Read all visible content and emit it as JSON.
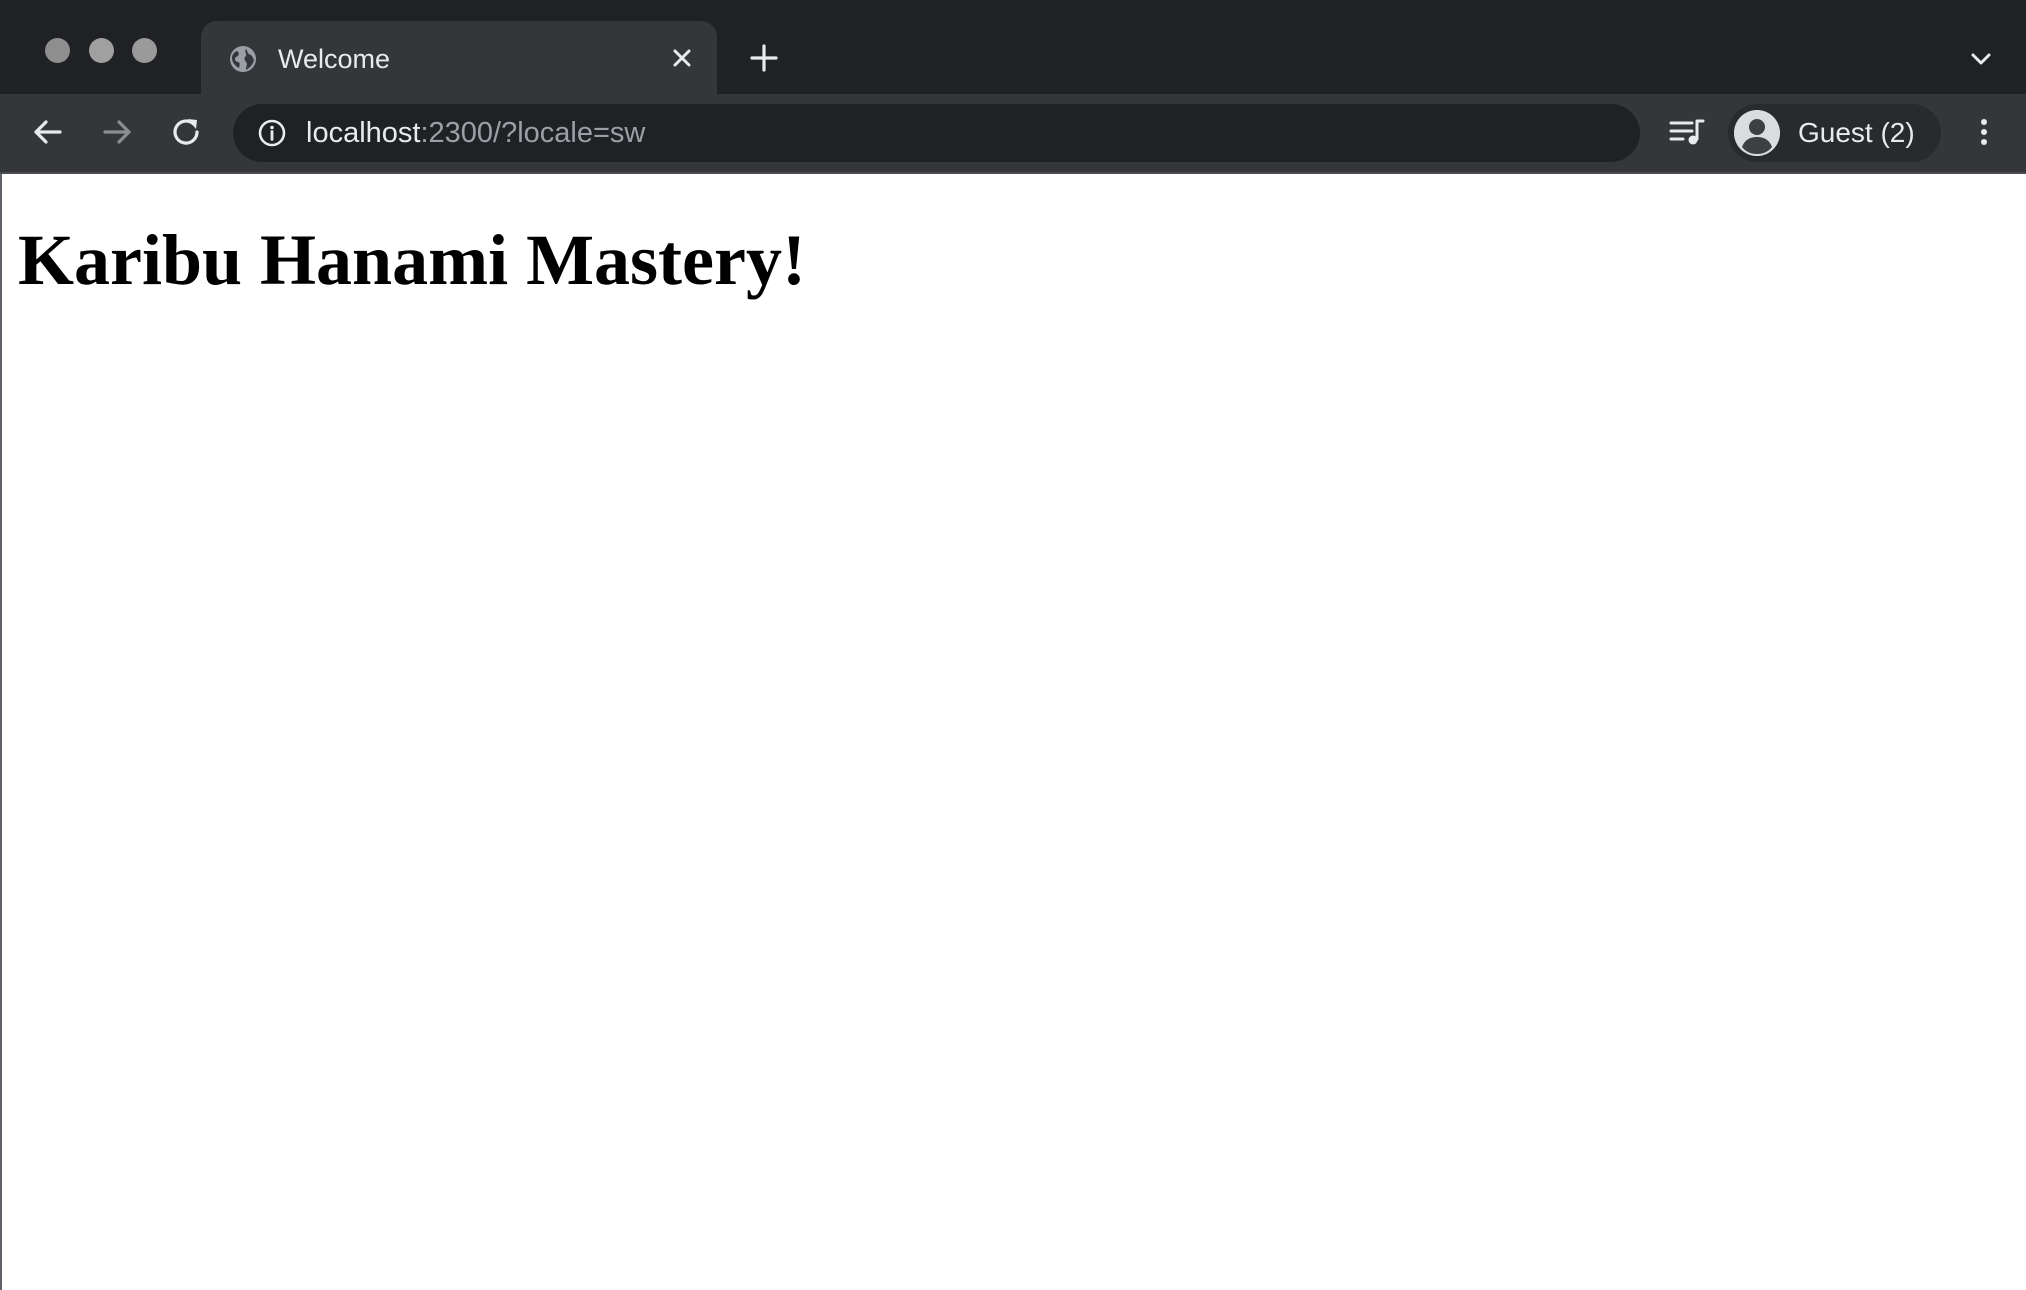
{
  "browser": {
    "tab": {
      "title": "Welcome",
      "favicon": "globe-icon"
    },
    "toolbar": {
      "url_host": "localhost",
      "url_rest": ":2300/?locale=sw",
      "profile_label": "Guest (2)"
    },
    "icons": {
      "back": "arrow-left-icon",
      "forward": "arrow-right-icon",
      "reload": "reload-icon",
      "site_info": "info-icon",
      "media": "media-control-icon",
      "avatar": "person-icon",
      "menu": "kebab-menu-icon",
      "new_tab": "plus-icon",
      "tab_close": "close-icon",
      "tab_search": "chevron-down-icon"
    },
    "colors": {
      "frame": "#202124",
      "toolbar": "#35363a",
      "omnibox": "#202124",
      "text_primary": "#e8eaed",
      "text_secondary": "#9aa0a6",
      "page_bg": "#ffffff"
    }
  },
  "page": {
    "heading": "Karibu Hanami Mastery!"
  }
}
